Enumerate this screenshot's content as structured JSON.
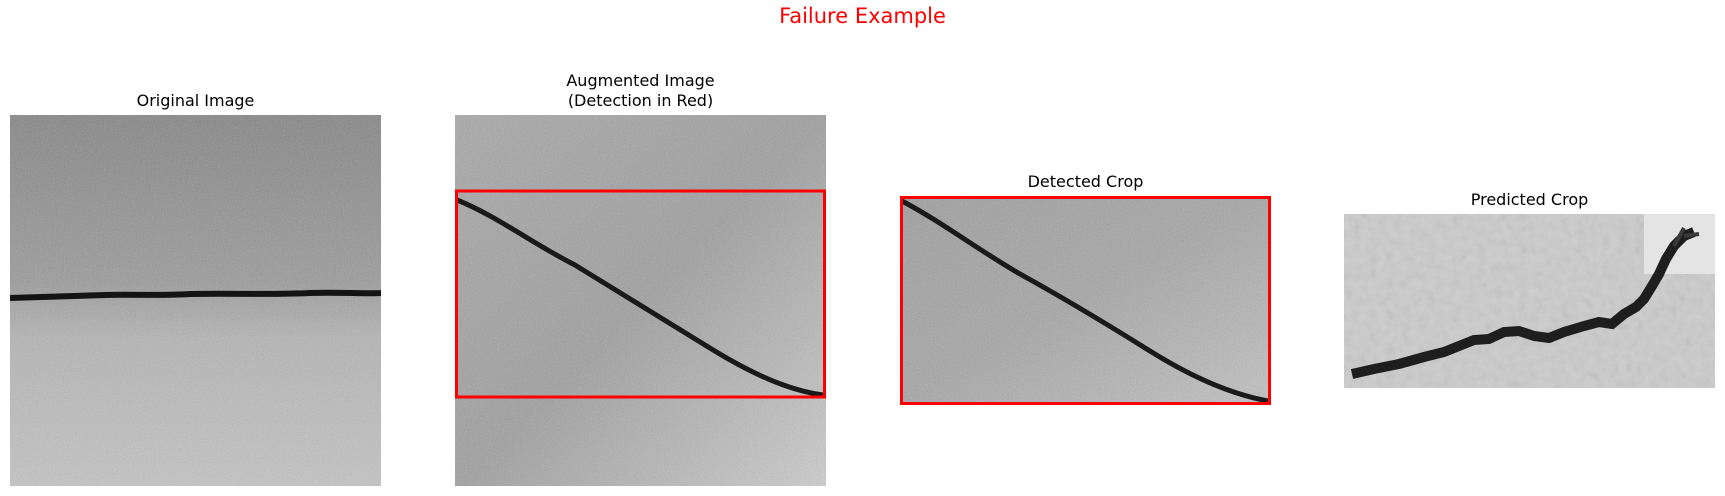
{
  "figure": {
    "title": "Failure Example",
    "title_color": "#ff0000",
    "box_color": "#ff0000"
  },
  "panels": [
    {
      "title": "Original Image",
      "content": "concrete surface with horizontal crack"
    },
    {
      "title": "Augmented Image\n(Detection in Red)",
      "content": "concrete surface with diagonal crack and red detection box"
    },
    {
      "title": "Detected Crop",
      "content": "cropped region with diagonal crack inside red border"
    },
    {
      "title": "Predicted Crop",
      "content": "low-resolution crop with jagged crack"
    }
  ]
}
